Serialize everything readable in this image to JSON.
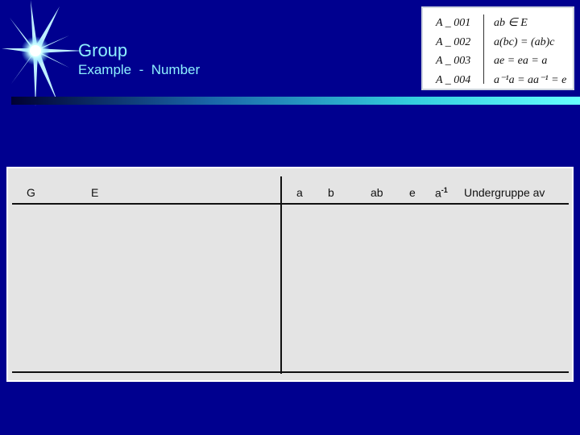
{
  "header": {
    "title": "Group",
    "subtitle": "Example  -  Number"
  },
  "axioms": {
    "ids": [
      "A _ 001",
      "A _ 002",
      "A _ 003",
      "A _ 004"
    ],
    "formulas": [
      "ab ∈ E",
      "a(bc) = (ab)c",
      "ae = ea = a",
      "a⁻¹a = aa⁻¹ = e"
    ]
  },
  "table": {
    "columns": {
      "g": "G",
      "e_set": "E",
      "a": "a",
      "b": "b",
      "ab": "ab",
      "e": "e",
      "a_inv_base": "a",
      "a_inv_exp": "-1",
      "subgroup": "Undergruppe av"
    }
  },
  "colors": {
    "background": "#00008f",
    "title_text": "#8ef0ff",
    "panel": "#e4e4e4"
  }
}
